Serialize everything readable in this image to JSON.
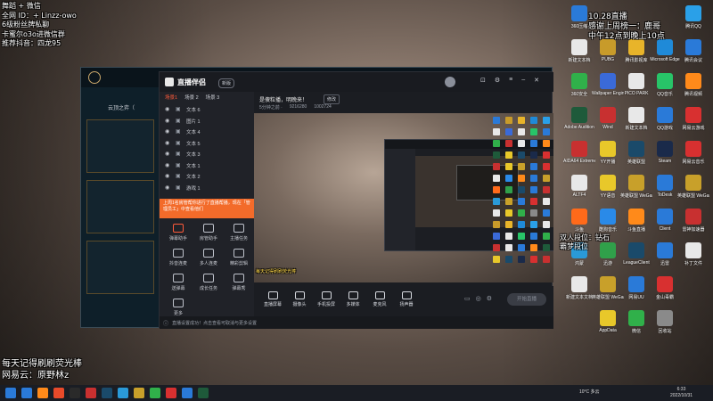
{
  "overlay": {
    "top_left_lines": [
      "舞蹈 + 微信",
      "全网 ID：+ Linzz-owo",
      "6级粉丝牌私聊",
      "卡蜜尔o3o进微信群",
      "推荐抖音：四龙95"
    ],
    "top_right_lines": [
      "10.28直播",
      "感谢上周榜一：鹿哥",
      "中午12点到晚上10点"
    ],
    "mid_right_lines": [
      "双人段位：钻石",
      "霸梦段位"
    ],
    "bottom_left_lines": [
      "每天记得刷刷荧光棒",
      "网易云：原野林z"
    ]
  },
  "app": {
    "title": "直播伴侣",
    "version_badge": "新版",
    "scene_tabs": [
      "场景1",
      "场景 2",
      "场景 3"
    ],
    "stream_title": "是傻粒播，明晚来！",
    "edit_label": "修改",
    "stats": [
      "5分钟之前 ·",
      "9216280",
      "1002724"
    ],
    "scenes": [
      {
        "name": "文本 6"
      },
      {
        "name": "图片 1"
      },
      {
        "name": "文本 4"
      },
      {
        "name": "文本 5"
      },
      {
        "name": "文本 3"
      },
      {
        "name": "文本 1"
      },
      {
        "name": "文本 2"
      },
      {
        "name": "游戏 1"
      }
    ],
    "notice_text": "上周1名房管帮你进行了直播帮播，现在「管理员工」中查看他们",
    "tools": [
      {
        "label": "弹幕助手",
        "icon": "danmaku-icon"
      },
      {
        "label": "房管助手",
        "icon": "admin-icon"
      },
      {
        "label": "主播任务",
        "icon": "task-icon"
      },
      {
        "label": "抖音连麦",
        "icon": "link-icon"
      },
      {
        "label": "多人连麦",
        "icon": "multi-icon"
      },
      {
        "label": "精彩剪辑",
        "icon": "clip-icon"
      },
      {
        "label": "送弹幕",
        "icon": "send-icon"
      },
      {
        "label": "成长任务",
        "icon": "growth-icon"
      },
      {
        "label": "弹幕秀",
        "icon": "show-icon"
      },
      {
        "label": "更多",
        "icon": "more-icon"
      }
    ],
    "controls": [
      "直播屏幕",
      "摄像头",
      "手机投屏",
      "多媒体",
      "麦克风",
      "扬声器"
    ],
    "start_button": "开始直播",
    "status_bar": "直播设置成功！点击查看可取消与更多设置",
    "overlay_hint": "每天记得刷刷荧光棒",
    "game_label": "云顶之弈（"
  },
  "desktop": {
    "icons": [
      {
        "label": "360压缩",
        "color": "#2a7ad8"
      },
      {
        "label": "PUBG",
        "color": "#c89b2a"
      },
      {
        "label": "腾讯影视库",
        "color": "#e8b42a"
      },
      {
        "label": "Microsoft Edge",
        "color": "#1f8ad8"
      },
      {
        "label": "腾讯QQ",
        "color": "#2aa0e8"
      },
      {
        "label": "新建文本档",
        "color": "#e8e8e8"
      },
      {
        "label": "Wallpaper Engine",
        "color": "#3a6ad8"
      },
      {
        "label": "PICO PARK",
        "color": "#e8e8e8"
      },
      {
        "label": "QQ音乐",
        "color": "#28c468"
      },
      {
        "label": "腾讯会议",
        "color": "#2a7ad8"
      },
      {
        "label": "360安全",
        "color": "#30b04a"
      },
      {
        "label": "Wind",
        "color": "#c83030"
      },
      {
        "label": "新建文本档",
        "color": "#e8e8e8"
      },
      {
        "label": "QQ游戏",
        "color": "#2a7ad8"
      },
      {
        "label": "腾讯视频",
        "color": "#ff8a1a"
      },
      {
        "label": "Adobe Audition",
        "color": "#1e5a3a"
      },
      {
        "label": "YY开播",
        "color": "#e8c82a"
      },
      {
        "label": "英雄联盟",
        "color": "#1a4a6a"
      },
      {
        "label": "Steam",
        "color": "#1a2a4a"
      },
      {
        "label": "网易云游戏",
        "color": "#d83030"
      },
      {
        "label": "AIDA64 Extreme",
        "color": "#c83030"
      },
      {
        "label": "YY语音",
        "color": "#e8c82a"
      },
      {
        "label": "英雄联盟 WeGame",
        "color": "#c8a02a"
      },
      {
        "label": "ToDesk",
        "color": "#2a7ad8"
      },
      {
        "label": "网易云音乐",
        "color": "#d83030"
      },
      {
        "label": "ALTF4",
        "color": "#e8e8e8"
      },
      {
        "label": "酷狗音乐",
        "color": "#2a8ae8"
      },
      {
        "label": "斗鱼直播",
        "color": "#ff8a1a"
      },
      {
        "label": "Client",
        "color": "#2a7ad8"
      },
      {
        "label": "英雄联盟 WeGame",
        "color": "#c8a02a"
      },
      {
        "label": "斗鱼",
        "color": "#ff6a1a"
      },
      {
        "label": "迅游",
        "color": "#30a04a"
      },
      {
        "label": "LeagueClient",
        "color": "#1a4a6a"
      },
      {
        "label": "迅雷",
        "color": "#2a7ad8"
      },
      {
        "label": "雷神加速器",
        "color": "#c83030"
      },
      {
        "label": "鸿蒙",
        "color": "#2a9ad8"
      },
      {
        "label": "英雄联盟 WeGame",
        "color": "#c8a02a"
      },
      {
        "label": "网易UU",
        "color": "#2a7ad8"
      },
      {
        "label": "金山毒霸",
        "color": "#d83030"
      },
      {
        "label": "补丁文件",
        "color": "#e8e8e8"
      },
      {
        "label": "新建文本文档",
        "color": "#e8e8e8"
      },
      {
        "label": "AppData",
        "color": "#e8c82a"
      },
      {
        "label": "微信",
        "color": "#30b04a"
      },
      {
        "label": "回收站",
        "color": "#8a8a8a"
      }
    ]
  },
  "taskbar": {
    "weather": "10°C 多云",
    "time": "6:33",
    "date": "2022/10/31",
    "apps": [
      "#2a7ad8",
      "#ff8a1a",
      "#e84a2a",
      "#2a2a2a",
      "#c83030",
      "#1a4a6a",
      "#2a9ad8",
      "#c8a02a",
      "#30b04a",
      "#d83030",
      "#2a7ad8",
      "#1e5a3a"
    ]
  }
}
